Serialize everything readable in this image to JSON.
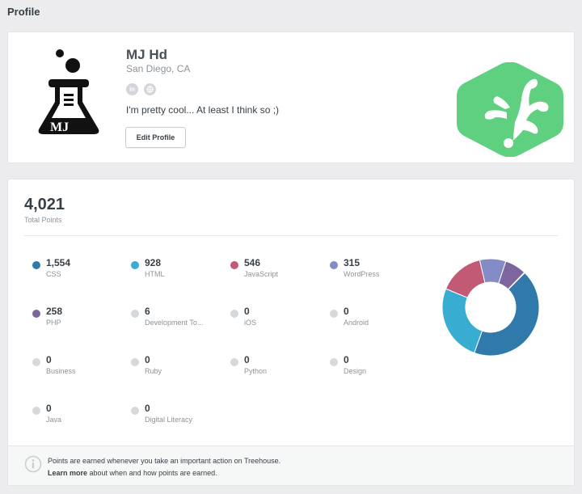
{
  "page": {
    "title": "Profile"
  },
  "profile": {
    "name": "MJ Hd",
    "location": "San Diego, CA",
    "bio": "I'm pretty cool... At least I think so ;)",
    "edit_label": "Edit Profile",
    "social_icons": [
      "linkedin-icon",
      "globe-icon"
    ],
    "avatar_text": "MJ",
    "logo_color": "#5fcf80"
  },
  "points": {
    "total_value": "4,021",
    "total_label": "Total Points",
    "categories": [
      {
        "value": "1,554",
        "label": "CSS",
        "color": "#3079ab"
      },
      {
        "value": "928",
        "label": "HTML",
        "color": "#39add1"
      },
      {
        "value": "546",
        "label": "JavaScript",
        "color": "#c25975"
      },
      {
        "value": "315",
        "label": "WordPress",
        "color": "#838cc7"
      },
      {
        "value": "258",
        "label": "PHP",
        "color": "#7d669e"
      },
      {
        "value": "6",
        "label": "Development To...",
        "color": "#d5d9dc"
      },
      {
        "value": "0",
        "label": "iOS",
        "color": "#d5d9dc"
      },
      {
        "value": "0",
        "label": "Android",
        "color": "#d5d9dc"
      },
      {
        "value": "0",
        "label": "Business",
        "color": "#d5d9dc"
      },
      {
        "value": "0",
        "label": "Ruby",
        "color": "#d5d9dc"
      },
      {
        "value": "0",
        "label": "Python",
        "color": "#d5d9dc"
      },
      {
        "value": "0",
        "label": "Design",
        "color": "#d5d9dc"
      },
      {
        "value": "0",
        "label": "Java",
        "color": "#d5d9dc"
      },
      {
        "value": "0",
        "label": "Digital Literacy",
        "color": "#d5d9dc"
      }
    ]
  },
  "footer": {
    "line1": "Points are earned whenever you take an important action on Treehouse.",
    "learn_more": "Learn more",
    "line2_rest": " about when and how points are earned."
  },
  "chart_data": {
    "type": "pie",
    "hole": true,
    "categories": [
      "CSS",
      "HTML",
      "JavaScript",
      "WordPress",
      "PHP",
      "Development Tools"
    ],
    "values": [
      1554,
      928,
      546,
      315,
      258,
      6
    ],
    "colors": [
      "#3079ab",
      "#39add1",
      "#c25975",
      "#838cc7",
      "#7d669e",
      "#d5d9dc"
    ]
  }
}
